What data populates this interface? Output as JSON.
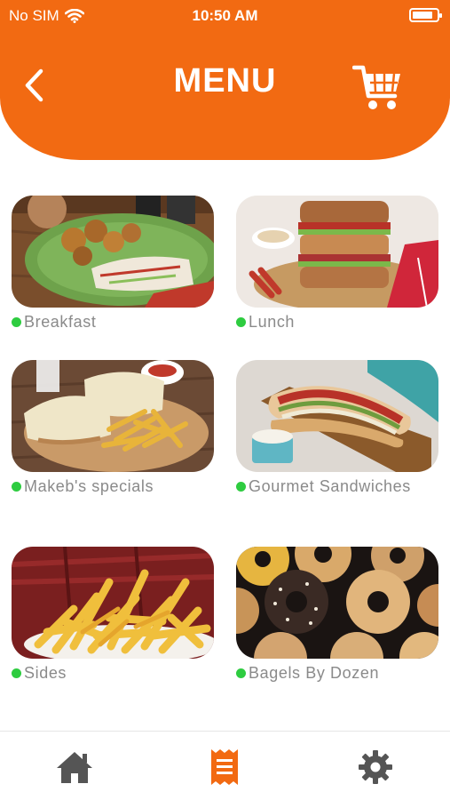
{
  "status": {
    "carrier": "No SIM",
    "time": "10:50 AM",
    "battery_level": 0.85
  },
  "header": {
    "title": "MENU",
    "back_icon": "chevron-left-icon",
    "cart_icon": "cart-icon"
  },
  "categories": [
    {
      "label": "Breakfast"
    },
    {
      "label": "Lunch"
    },
    {
      "label": "Makeb's specials"
    },
    {
      "label": "Gourmet Sandwiches"
    },
    {
      "label": "Sides"
    },
    {
      "label": "Bagels By Dozen"
    }
  ],
  "bottom_nav": [
    {
      "icon": "home-icon",
      "active": false
    },
    {
      "icon": "receipt-icon",
      "active": true
    },
    {
      "icon": "gear-icon",
      "active": false
    }
  ],
  "colors": {
    "brand": "#F26A12",
    "dot": "#2ECC40",
    "nav_inactive": "#555555",
    "label": "#8a8a8a"
  }
}
